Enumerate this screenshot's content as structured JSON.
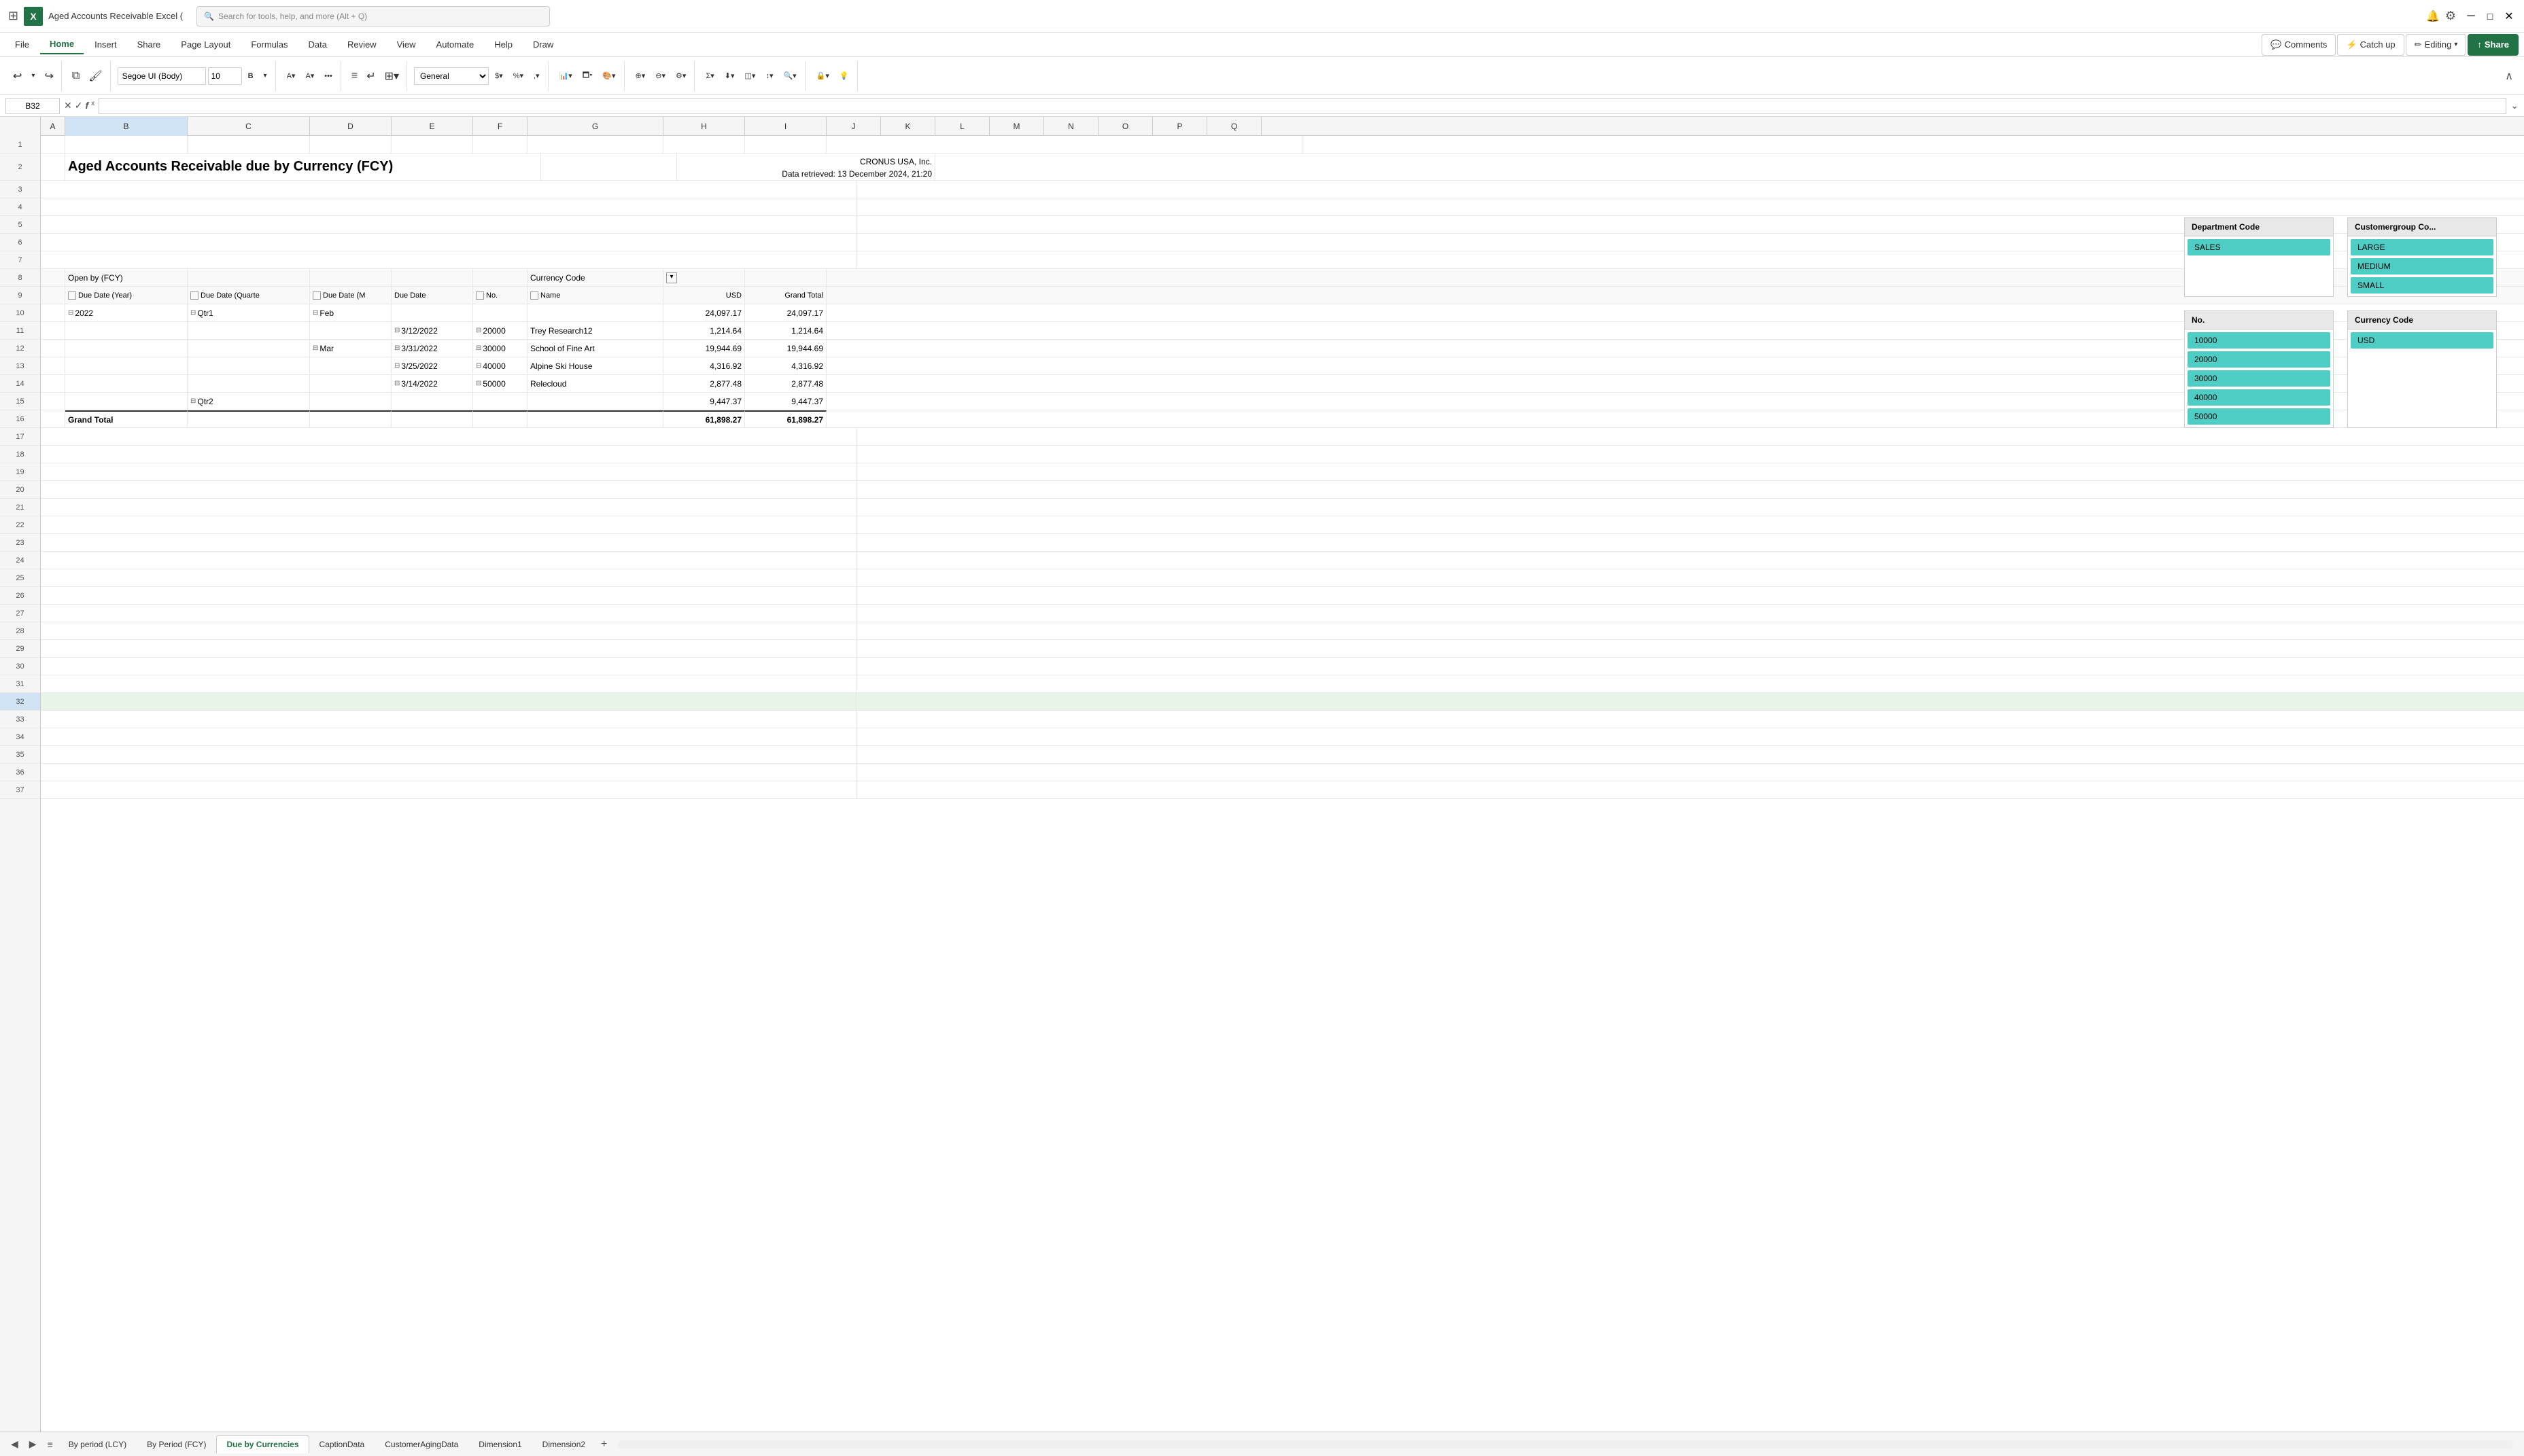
{
  "titlebar": {
    "app_icon": "X",
    "title": "Aged Accounts Receivable Excel (",
    "search_placeholder": "Search for tools, help, and more (Alt + Q)",
    "settings_icon": "⚙"
  },
  "ribbon": {
    "tabs": [
      "File",
      "Home",
      "Insert",
      "Share",
      "Page Layout",
      "Formulas",
      "Data",
      "Review",
      "View",
      "Automate",
      "Help",
      "Draw"
    ],
    "active_tab": "Home",
    "font_name": "Segoe UI (Body)",
    "font_size": "10",
    "format": "General",
    "comments_label": "Comments",
    "catch_up_label": "Catch up",
    "editing_label": "Editing",
    "share_label": "Share"
  },
  "formula_bar": {
    "cell_ref": "B32",
    "formula": ""
  },
  "spreadsheet": {
    "title": "Aged Accounts Receivable due by Currency (FCY)",
    "company": "CRONUS USA, Inc.",
    "data_retrieved": "Data retrieved: 13 December 2024, 21:20",
    "pivot_label": "Open by (FCY)",
    "currency_label": "Currency Code",
    "headers": [
      "Due Date (Year)",
      "Due Date (Quarte",
      "Due Date (M",
      "Due Date",
      "No.",
      "Name",
      "USD",
      "Grand Total"
    ],
    "rows": [
      {
        "year": "2022",
        "qtr": "Qtr1",
        "month": "Feb",
        "date": "",
        "no": "",
        "name": "",
        "usd": "24,097.17",
        "total": "24,097.17"
      },
      {
        "year": "",
        "qtr": "",
        "month": "",
        "date": "3/12/2022",
        "no": "20000",
        "name": "Trey Research12",
        "usd": "1,214.64",
        "total": "1,214.64"
      },
      {
        "year": "",
        "qtr": "",
        "month": "Mar",
        "date": "3/31/2022",
        "no": "30000",
        "name": "School of Fine Art",
        "usd": "19,944.69",
        "total": "19,944.69"
      },
      {
        "year": "",
        "qtr": "",
        "month": "",
        "date": "3/25/2022",
        "no": "40000",
        "name": "Alpine Ski House",
        "usd": "4,316.92",
        "total": "4,316.92"
      },
      {
        "year": "",
        "qtr": "",
        "month": "",
        "date": "3/14/2022",
        "no": "50000",
        "name": "Relecloud",
        "usd": "2,877.48",
        "total": "2,877.48"
      },
      {
        "year": "",
        "qtr": "Qtr2",
        "month": "",
        "date": "",
        "no": "",
        "name": "",
        "usd": "9,447.37",
        "total": "9,447.37"
      }
    ],
    "grand_total_label": "Grand Total",
    "grand_total_usd": "61,898.27",
    "grand_total": "61,898.27"
  },
  "pivot_panels": {
    "department": {
      "title": "Department Code",
      "items": [
        "SALES"
      ]
    },
    "customergroup": {
      "title": "Customergroup Co...",
      "items": [
        "LARGE",
        "MEDIUM",
        "SMALL"
      ]
    },
    "no": {
      "title": "No.",
      "items": [
        "10000",
        "20000",
        "30000",
        "40000",
        "50000"
      ]
    },
    "currency": {
      "title": "Currency Code",
      "items": [
        "USD"
      ]
    }
  },
  "sheet_tabs": [
    {
      "label": "By period (LCY)",
      "active": false
    },
    {
      "label": "By Period (FCY)",
      "active": false
    },
    {
      "label": "Due by Currencies",
      "active": true
    },
    {
      "label": "CaptionData",
      "active": false
    },
    {
      "label": "CustomerAgingData",
      "active": false
    },
    {
      "label": "Dimension1",
      "active": false
    },
    {
      "label": "Dimension2",
      "active": false
    }
  ],
  "columns": {
    "letters": [
      "A",
      "B",
      "C",
      "D",
      "E",
      "F",
      "G",
      "H",
      "I",
      "J",
      "K",
      "L",
      "M",
      "N",
      "O",
      "P",
      "Q"
    ],
    "widths": [
      36,
      180,
      180,
      120,
      120,
      80,
      200,
      120,
      120,
      80,
      80,
      80,
      80,
      80,
      80,
      80,
      80
    ]
  }
}
